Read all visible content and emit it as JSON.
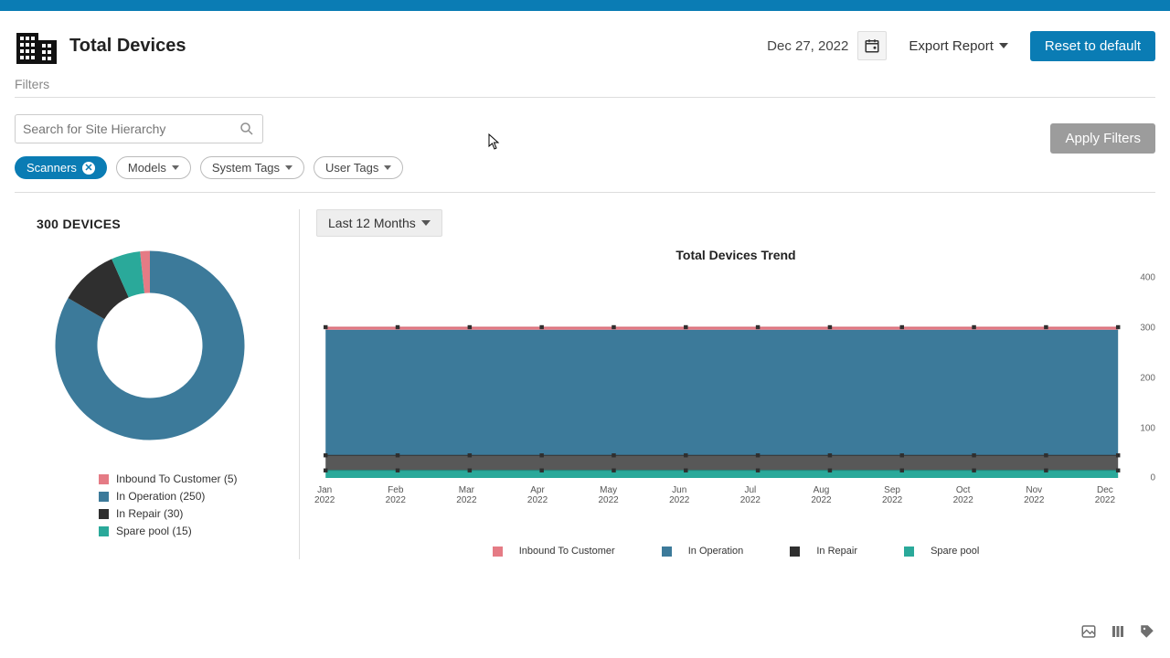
{
  "header": {
    "title": "Total Devices",
    "date": "Dec 27, 2022",
    "export_label": "Export Report",
    "reset_label": "Reset to default"
  },
  "filters": {
    "section_label": "Filters",
    "search_placeholder": "Search for Site Hierarchy",
    "apply_label": "Apply Filters",
    "chips": {
      "scanners": "Scanners",
      "models": "Models",
      "system_tags": "System Tags",
      "user_tags": "User Tags"
    }
  },
  "donut": {
    "count_label": "300 DEVICES",
    "legend": {
      "inbound": "Inbound To Customer (5)",
      "in_op": "In Operation (250)",
      "in_repair": "In Repair (30)",
      "spare": "Spare pool (15)"
    },
    "colors": {
      "inbound": "#e57b85",
      "in_op": "#3c7a9a",
      "in_repair": "#2f2f2f",
      "spare": "#2aa99a"
    }
  },
  "trend": {
    "range_label": "Last 12 Months",
    "title": "Total Devices Trend",
    "legend": {
      "inbound": "Inbound To Customer",
      "in_op": "In Operation",
      "in_repair": "In Repair",
      "spare": "Spare pool"
    },
    "yticks": [
      "0",
      "100",
      "200",
      "300",
      "400"
    ],
    "xticks": [
      "Jan 2022",
      "Feb 2022",
      "Mar 2022",
      "Apr 2022",
      "May 2022",
      "Jun 2022",
      "Jul 2022",
      "Aug 2022",
      "Sep 2022",
      "Oct 2022",
      "Nov 2022",
      "Dec 2022"
    ]
  },
  "chart_data": [
    {
      "type": "pie",
      "title": "300 DEVICES",
      "series": [
        {
          "name": "Inbound To Customer",
          "values": [
            5
          ]
        },
        {
          "name": "In Operation",
          "values": [
            250
          ]
        },
        {
          "name": "In Repair",
          "values": [
            30
          ]
        },
        {
          "name": "Spare pool",
          "values": [
            15
          ]
        }
      ]
    },
    {
      "type": "area",
      "title": "Total Devices Trend",
      "ylabel": "",
      "xlabel": "",
      "ylim": [
        0,
        400
      ],
      "categories": [
        "Jan 2022",
        "Feb 2022",
        "Mar 2022",
        "Apr 2022",
        "May 2022",
        "Jun 2022",
        "Jul 2022",
        "Aug 2022",
        "Sep 2022",
        "Oct 2022",
        "Nov 2022",
        "Dec 2022"
      ],
      "series": [
        {
          "name": "Spare pool",
          "values": [
            15,
            15,
            15,
            15,
            15,
            15,
            15,
            15,
            15,
            15,
            15,
            15
          ]
        },
        {
          "name": "In Repair",
          "values": [
            30,
            30,
            30,
            30,
            30,
            30,
            30,
            30,
            30,
            30,
            30,
            30
          ]
        },
        {
          "name": "In Operation",
          "values": [
            250,
            250,
            250,
            250,
            250,
            250,
            250,
            250,
            250,
            250,
            250,
            250
          ]
        },
        {
          "name": "Inbound To Customer",
          "values": [
            5,
            5,
            5,
            5,
            5,
            5,
            5,
            5,
            5,
            5,
            5,
            5
          ]
        }
      ]
    }
  ]
}
